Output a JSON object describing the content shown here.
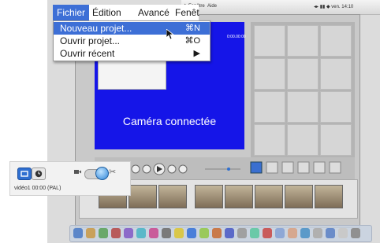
{
  "menubar": {
    "items": [
      "Fichier",
      "Édition",
      "Avancé",
      "Fenêt"
    ]
  },
  "file_menu": {
    "items": [
      {
        "label": "Nouveau projet...",
        "shortcut": "⌘N"
      },
      {
        "label": "Ouvrir projet...",
        "shortcut": "⌘O"
      },
      {
        "label": "Ouvrir récent",
        "shortcut": "▶"
      }
    ]
  },
  "monitor": {
    "message": "Caméra connectée",
    "timecode": "0:00.00:00"
  },
  "status": {
    "text": "vidéo1  00:00 (PAL)"
  },
  "colors": {
    "menu_highlight": "#3d6fd6",
    "monitor_bg": "#1515e8",
    "camera_button": "#2f6fd0"
  },
  "icons": {
    "camera_mode": "camera-mode-icon",
    "clock_mode": "clock-icon",
    "toggle": "mode-toggle-switch",
    "small_camera": "camera-small-icon",
    "scissors": "scissors-icon",
    "cursor": "mouse-pointer-icon"
  }
}
